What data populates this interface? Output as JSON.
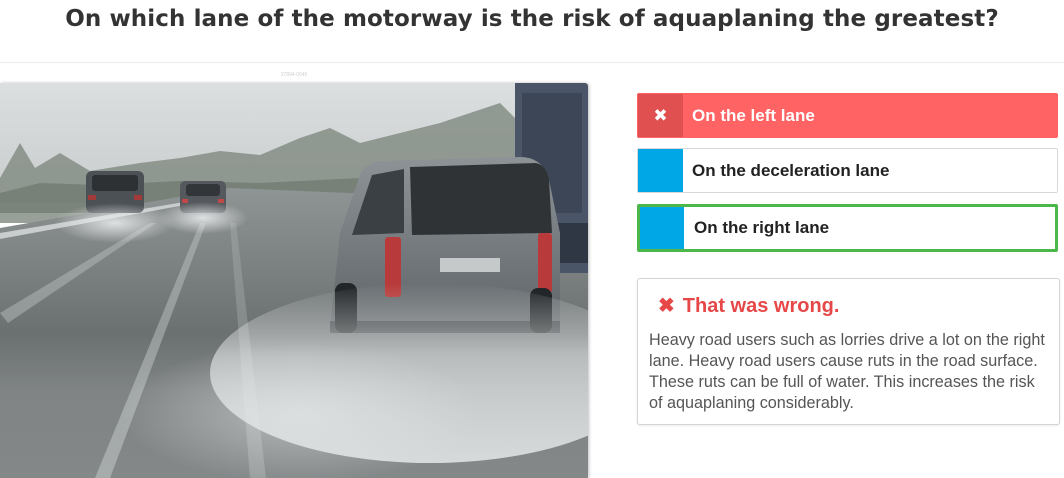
{
  "question": "On which lane of the motorway is the risk of aquaplaning the greatest?",
  "image": {
    "caption": "37894-0045",
    "alt": "Cars driving on a wet motorway in heavy spray"
  },
  "answers": [
    {
      "label": "On the left lane",
      "state": "wrong",
      "marker_icon": "✖"
    },
    {
      "label": "On the deceleration lane",
      "state": "neutral",
      "marker_icon": ""
    },
    {
      "label": "On the right lane",
      "state": "correct",
      "marker_icon": ""
    }
  ],
  "feedback": {
    "icon": "✖",
    "title": "That was wrong.",
    "text": "Heavy road users such as lorries drive a lot on the right lane. Heavy road users cause ruts in the road surface. These ruts can be full of water. This increases the risk of aquaplaning considerably."
  },
  "colors": {
    "wrong": "#ff6363",
    "neutral_marker": "#00a7e6",
    "correct_border": "#4cb84c",
    "feedback_title": "#e64848"
  }
}
